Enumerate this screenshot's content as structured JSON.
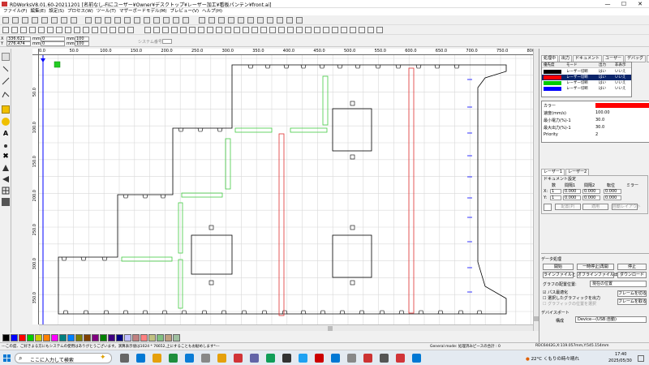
{
  "window": {
    "title": "RDWorksV8.01.60-20211201 [名前なし-Fiにユーザー¥Owner¥デスクトップ¥レーザー加工¥看板パンテン¥front.ai]",
    "minimize": "—",
    "maximize": "☐",
    "close": "✕"
  },
  "menu": [
    "ファイル(F)",
    "編集(E)",
    "設定(S)",
    "プロセス(W)",
    "ツール(T)",
    "マザーボードモデル(M)",
    "プレビュー(V)",
    "ヘルプ(H)"
  ],
  "coord": {
    "x_value": "336.621",
    "y_value": "276.474",
    "w_value": "0",
    "h_value": "0",
    "unit": "mm",
    "pct1": "100",
    "pct2": "100",
    "opt_label": "システム番号"
  },
  "ruler": {
    "h_ticks": [
      "0.0",
      "50.0",
      "100.0",
      "150.0",
      "200.0",
      "250.0",
      "300.0",
      "350.0",
      "400.0",
      "450.0",
      "500.0",
      "550.0",
      "600.0",
      "650.0",
      "700.0",
      "750.0",
      "800.0"
    ],
    "v_ticks": [
      "50.0",
      "100.0",
      "150.0",
      "200.0",
      "250.0",
      "300.0",
      "350.0"
    ]
  },
  "colors": {
    "black": "#000000",
    "red": "#ff0000",
    "green": "#00cc00",
    "blue": "#0000ff",
    "line_green": "#44cc44",
    "line_red": "#e03030",
    "accent": "#0a246a"
  },
  "palette": [
    "#000000",
    "#0000ff",
    "#ff0000",
    "#00cc00",
    "#cccc00",
    "#ff8000",
    "#ff00ff",
    "#008080",
    "#0080ff",
    "#808000",
    "#804000",
    "#800080",
    "#008000",
    "#400080",
    "#000080",
    "#c0c0ff",
    "#c08080",
    "#ff8080",
    "#c0c080",
    "#80c080",
    "#c0a080",
    "#a0c0a0"
  ],
  "panel": {
    "tabs": [
      "処理中",
      "出力",
      "ドキュメント",
      "ユーザー",
      "デバッグ",
      "変換"
    ],
    "layer_headers": [
      "優先度",
      "モード",
      "出力",
      "非表示"
    ],
    "layers": [
      {
        "color": "#000000",
        "mode": "レーザー切断",
        "output": "はい",
        "hidden": "いいえ"
      },
      {
        "color": "#ff0000",
        "mode": "レーザー切断",
        "output": "はい",
        "hidden": "いいえ"
      },
      {
        "color": "#00cc00",
        "mode": "レーザー切断",
        "output": "はい",
        "hidden": "いいえ"
      },
      {
        "color": "#0000ff",
        "mode": "レーザー切断",
        "output": "はい",
        "hidden": "いいえ"
      }
    ],
    "props": [
      {
        "k": "カラー",
        "v": ""
      },
      {
        "k": "速度(mm/s)",
        "v": "100.00"
      },
      {
        "k": "最小電力(%)-1",
        "v": "30.0"
      },
      {
        "k": "最大出力(%)-1",
        "v": "30.0"
      },
      {
        "k": "Priority",
        "v": "2"
      }
    ],
    "laser_tabs": [
      "レーザー1",
      "レーザー2"
    ],
    "array_label": "ドキュメント設定",
    "array_cols": [
      "数",
      "間隔1",
      "間隔2",
      "転位",
      "ミラー"
    ],
    "array_rows": [
      {
        "axis": "X:",
        "n": "1",
        "i1": "0.000",
        "i2": "0.000",
        "sh": "0.000"
      },
      {
        "axis": "Y:",
        "n": "1",
        "i1": "0.000",
        "i2": "0.000",
        "sh": "0.000"
      }
    ],
    "array_btns": [
      "配置(P)",
      "適用",
      "自動レイアウト"
    ],
    "data_label": "データ処理",
    "btn_start": "開始",
    "btn_pause": "一時停止|再開",
    "btn_stop": "停止",
    "btn_save": "ラインファイルとして",
    "btn_offline": "オフラインファイル出力",
    "btn_download": "ダウンロード",
    "pos_label": "グラフの配置位置:",
    "pos_value": "現在の位置",
    "chk1": "パス最適化",
    "chk2": "選択したグラフィックを出力",
    "chk3": "グラフィックの位置を選択",
    "btn_frame1": "フレームを切る",
    "btn_frame2": "フレームを取る",
    "device_label": "デバイスポート",
    "device_k": "構成",
    "device_v": "Device—(USB:自動)"
  },
  "status": {
    "left": "---この度、ご好きよる方にもシステムの使用はありがとうございます。演算表示値は1024 * 76652,上にすることもお勧めします*---",
    "mode": "General mode: 処理済みピースの合計 : 0",
    "coords": "RDC6442G,X:119.057mm,Y:545.154mm"
  },
  "taskbar": {
    "search": "ここに入力して検索",
    "weather": "22°C くもりの時々晴れ",
    "time": "17:40",
    "date": "2025/05/30"
  }
}
